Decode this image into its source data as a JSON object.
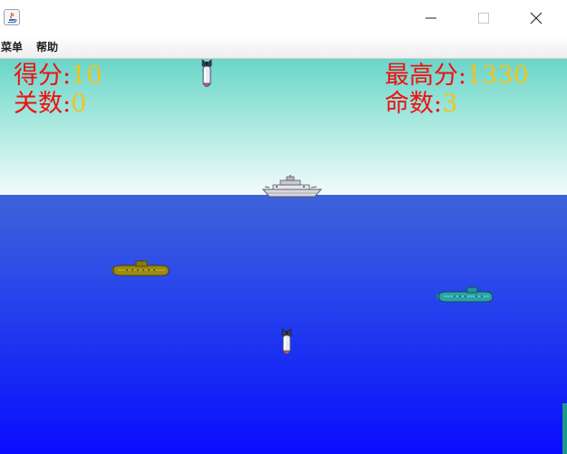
{
  "window": {
    "title": "",
    "controls": [
      "minimize-icon",
      "maximize-icon",
      "close-icon"
    ]
  },
  "menu": {
    "items": [
      {
        "label": "菜单"
      },
      {
        "label": "帮助"
      }
    ]
  },
  "hud": {
    "score_label": "得分:",
    "score": "10",
    "level_label": "关数:",
    "level": "0",
    "high_label": "最高分:",
    "high": "1330",
    "lives_label": "命数:",
    "lives": "3"
  },
  "sprites": [
    "bomb",
    "ship",
    "submarine-olive",
    "submarine-teal",
    "bomb"
  ],
  "colors": {
    "label": "#f01010",
    "value": "#f4c21a",
    "sky_top": "#6ad5c8",
    "sea_top": "#3e63da",
    "sea_bottom": "#0a0cff"
  }
}
